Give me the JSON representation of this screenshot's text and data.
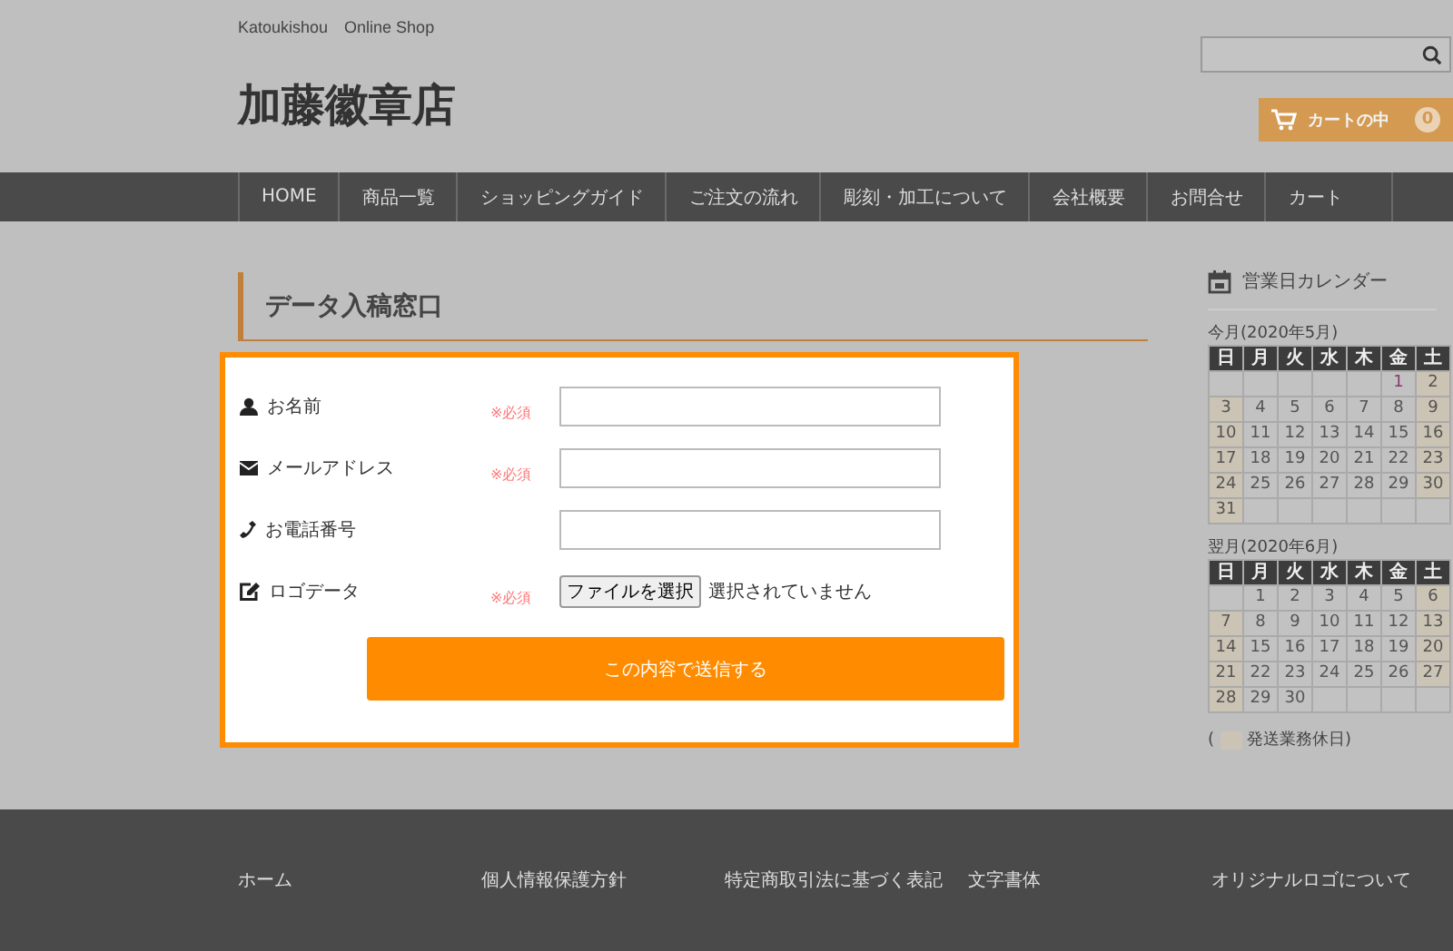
{
  "header": {
    "tagline": "Katoukishou　Online Shop",
    "logo": "加藤徽章店",
    "cart": {
      "label": "カートの中",
      "count": "0"
    }
  },
  "nav": [
    "HOME",
    "商品一覧",
    "ショッピングガイド",
    "ご注文の流れ",
    "彫刻・加工について",
    "会社概要",
    "お問合せ",
    "カート"
  ],
  "page_title": "データ入稿窓口",
  "form": {
    "fields": [
      {
        "kind": "text",
        "label": "お名前",
        "required_text": "※必須"
      },
      {
        "kind": "text",
        "label": "メールアドレス",
        "required_text": "※必須"
      },
      {
        "kind": "text",
        "label": "お電話番号"
      },
      {
        "kind": "file",
        "label": "ロゴデータ",
        "required_text": "※必須",
        "button": "ファイルを選択",
        "status": "選択されていません"
      }
    ],
    "submit": "この内容で送信する"
  },
  "calendar": {
    "title": "営業日カレンダー",
    "months": [
      {
        "caption": "今月(2020年5月)",
        "weekdays": [
          "日",
          "月",
          "火",
          "水",
          "木",
          "金",
          "土"
        ],
        "weeks": [
          [
            {
              "kind": "blank"
            },
            {
              "kind": "blank"
            },
            {
              "kind": "blank"
            },
            {
              "kind": "blank"
            },
            {
              "kind": "blank"
            },
            {
              "kind": "day",
              "d": "1",
              "holiday": false,
              "today": true
            },
            {
              "kind": "day",
              "d": "2",
              "holiday": true,
              "today": false
            }
          ],
          [
            {
              "kind": "day",
              "d": "3",
              "holiday": true,
              "today": false
            },
            {
              "kind": "day",
              "d": "4",
              "holiday": false,
              "today": false
            },
            {
              "kind": "day",
              "d": "5",
              "holiday": false,
              "today": false
            },
            {
              "kind": "day",
              "d": "6",
              "holiday": false,
              "today": false
            },
            {
              "kind": "day",
              "d": "7",
              "holiday": false,
              "today": false
            },
            {
              "kind": "day",
              "d": "8",
              "holiday": false,
              "today": false
            },
            {
              "kind": "day",
              "d": "9",
              "holiday": true,
              "today": false
            }
          ],
          [
            {
              "kind": "day",
              "d": "10",
              "holiday": true,
              "today": false
            },
            {
              "kind": "day",
              "d": "11",
              "holiday": false,
              "today": false
            },
            {
              "kind": "day",
              "d": "12",
              "holiday": false,
              "today": false
            },
            {
              "kind": "day",
              "d": "13",
              "holiday": false,
              "today": false
            },
            {
              "kind": "day",
              "d": "14",
              "holiday": false,
              "today": false
            },
            {
              "kind": "day",
              "d": "15",
              "holiday": false,
              "today": false
            },
            {
              "kind": "day",
              "d": "16",
              "holiday": true,
              "today": false
            }
          ],
          [
            {
              "kind": "day",
              "d": "17",
              "holiday": true,
              "today": false
            },
            {
              "kind": "day",
              "d": "18",
              "holiday": false,
              "today": false
            },
            {
              "kind": "day",
              "d": "19",
              "holiday": false,
              "today": false
            },
            {
              "kind": "day",
              "d": "20",
              "holiday": false,
              "today": false
            },
            {
              "kind": "day",
              "d": "21",
              "holiday": false,
              "today": false
            },
            {
              "kind": "day",
              "d": "22",
              "holiday": false,
              "today": false
            },
            {
              "kind": "day",
              "d": "23",
              "holiday": true,
              "today": false
            }
          ],
          [
            {
              "kind": "day",
              "d": "24",
              "holiday": true,
              "today": false
            },
            {
              "kind": "day",
              "d": "25",
              "holiday": false,
              "today": false
            },
            {
              "kind": "day",
              "d": "26",
              "holiday": false,
              "today": false
            },
            {
              "kind": "day",
              "d": "27",
              "holiday": false,
              "today": false
            },
            {
              "kind": "day",
              "d": "28",
              "holiday": false,
              "today": false
            },
            {
              "kind": "day",
              "d": "29",
              "holiday": false,
              "today": false
            },
            {
              "kind": "day",
              "d": "30",
              "holiday": true,
              "today": false
            }
          ],
          [
            {
              "kind": "day",
              "d": "31",
              "holiday": true,
              "today": false
            },
            {
              "kind": "blank"
            },
            {
              "kind": "blank"
            },
            {
              "kind": "blank"
            },
            {
              "kind": "blank"
            },
            {
              "kind": "blank"
            },
            {
              "kind": "blank"
            }
          ]
        ]
      },
      {
        "caption": "翌月(2020年6月)",
        "weekdays": [
          "日",
          "月",
          "火",
          "水",
          "木",
          "金",
          "土"
        ],
        "weeks": [
          [
            {
              "kind": "blank"
            },
            {
              "kind": "day",
              "d": "1",
              "holiday": false,
              "today": false
            },
            {
              "kind": "day",
              "d": "2",
              "holiday": false,
              "today": false
            },
            {
              "kind": "day",
              "d": "3",
              "holiday": false,
              "today": false
            },
            {
              "kind": "day",
              "d": "4",
              "holiday": false,
              "today": false
            },
            {
              "kind": "day",
              "d": "5",
              "holiday": false,
              "today": false
            },
            {
              "kind": "day",
              "d": "6",
              "holiday": true,
              "today": false
            }
          ],
          [
            {
              "kind": "day",
              "d": "7",
              "holiday": true,
              "today": false
            },
            {
              "kind": "day",
              "d": "8",
              "holiday": false,
              "today": false
            },
            {
              "kind": "day",
              "d": "9",
              "holiday": false,
              "today": false
            },
            {
              "kind": "day",
              "d": "10",
              "holiday": false,
              "today": false
            },
            {
              "kind": "day",
              "d": "11",
              "holiday": false,
              "today": false
            },
            {
              "kind": "day",
              "d": "12",
              "holiday": false,
              "today": false
            },
            {
              "kind": "day",
              "d": "13",
              "holiday": true,
              "today": false
            }
          ],
          [
            {
              "kind": "day",
              "d": "14",
              "holiday": true,
              "today": false
            },
            {
              "kind": "day",
              "d": "15",
              "holiday": false,
              "today": false
            },
            {
              "kind": "day",
              "d": "16",
              "holiday": false,
              "today": false
            },
            {
              "kind": "day",
              "d": "17",
              "holiday": false,
              "today": false
            },
            {
              "kind": "day",
              "d": "18",
              "holiday": false,
              "today": false
            },
            {
              "kind": "day",
              "d": "19",
              "holiday": false,
              "today": false
            },
            {
              "kind": "day",
              "d": "20",
              "holiday": true,
              "today": false
            }
          ],
          [
            {
              "kind": "day",
              "d": "21",
              "holiday": true,
              "today": false
            },
            {
              "kind": "day",
              "d": "22",
              "holiday": false,
              "today": false
            },
            {
              "kind": "day",
              "d": "23",
              "holiday": false,
              "today": false
            },
            {
              "kind": "day",
              "d": "24",
              "holiday": false,
              "today": false
            },
            {
              "kind": "day",
              "d": "25",
              "holiday": false,
              "today": false
            },
            {
              "kind": "day",
              "d": "26",
              "holiday": false,
              "today": false
            },
            {
              "kind": "day",
              "d": "27",
              "holiday": true,
              "today": false
            }
          ],
          [
            {
              "kind": "day",
              "d": "28",
              "holiday": true,
              "today": false
            },
            {
              "kind": "day",
              "d": "29",
              "holiday": false,
              "today": false
            },
            {
              "kind": "day",
              "d": "30",
              "holiday": false,
              "today": false
            },
            {
              "kind": "blank"
            },
            {
              "kind": "blank"
            },
            {
              "kind": "blank"
            },
            {
              "kind": "blank"
            }
          ]
        ]
      }
    ],
    "legend": {
      "open": "(",
      "label": "発送業務休日)"
    }
  },
  "footer": [
    "ホーム",
    "個人情報保護方針",
    "特定商取引法に基づく表記",
    "文字書体",
    "オリジナルロゴについて"
  ]
}
